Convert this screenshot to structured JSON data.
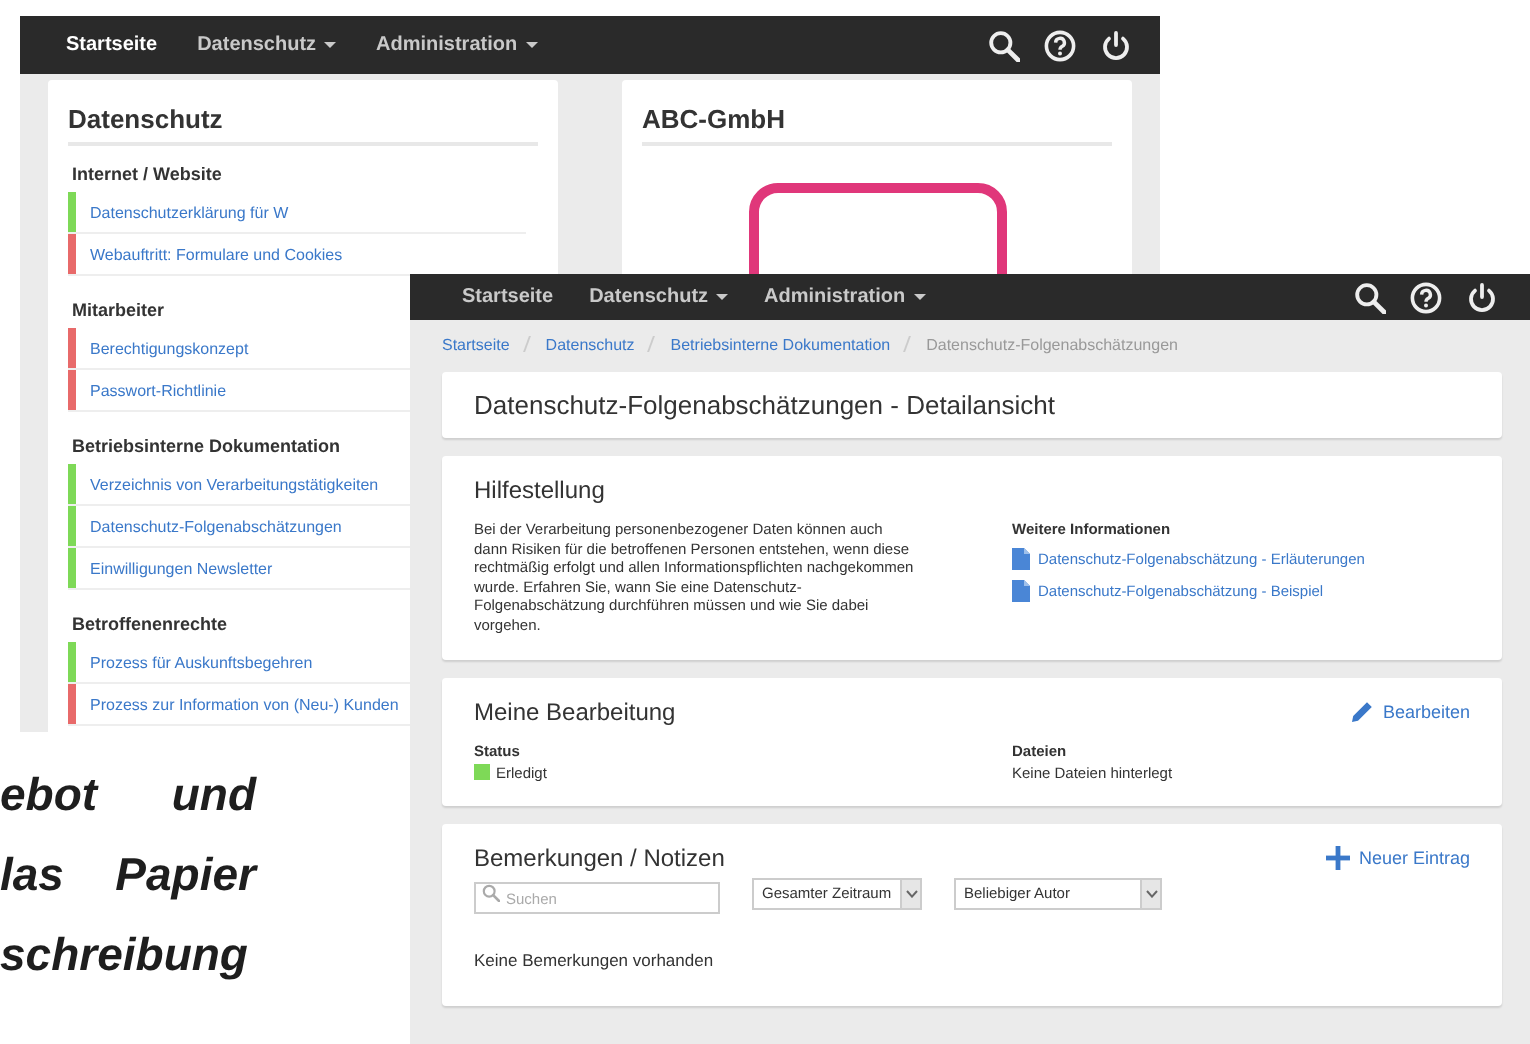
{
  "back_window": {
    "nav": [
      {
        "label": "Startseite",
        "selected": true,
        "dropdown": false
      },
      {
        "label": "Datenschutz",
        "selected": false,
        "dropdown": true
      },
      {
        "label": "Administration",
        "selected": false,
        "dropdown": true
      }
    ],
    "privacy_card": {
      "title": "Datenschutz",
      "groups": [
        {
          "heading": "Internet / Website",
          "items": [
            {
              "label": "Datenschutzerklärung für W",
              "color": "#7ed957"
            },
            {
              "label": "Webauftritt: Formulare und Cookies",
              "color": "#e86a6a"
            }
          ]
        },
        {
          "heading": "Mitarbeiter",
          "items": [
            {
              "label": "Berechtigungskonzept",
              "color": "#e86a6a"
            },
            {
              "label": "Passwort-Richtlinie",
              "color": "#e86a6a"
            }
          ]
        },
        {
          "heading": "Betriebsinterne Dokumentation",
          "items": [
            {
              "label": "Verzeichnis von Verarbeitungstätigkeiten",
              "color": "#7ed957"
            },
            {
              "label": "Datenschutz-Folgenabschätzungen",
              "color": "#7ed957"
            },
            {
              "label": "Einwilligungen Newsletter",
              "color": "#7ed957"
            }
          ]
        },
        {
          "heading": "Betroffenenrechte",
          "items": [
            {
              "label": "Prozess für Auskunftsbegehren",
              "color": "#7ed957"
            },
            {
              "label": "Prozess zur Information von (Neu-) Kunden",
              "color": "#e86a6a"
            }
          ]
        }
      ]
    },
    "company_card": {
      "title": "ABC-GmbH"
    }
  },
  "front_window": {
    "nav": [
      {
        "label": "Startseite",
        "selected": false,
        "dropdown": false
      },
      {
        "label": "Datenschutz",
        "selected": false,
        "dropdown": true
      },
      {
        "label": "Administration",
        "selected": false,
        "dropdown": true
      }
    ],
    "breadcrumb": [
      "Startseite",
      "Datenschutz",
      "Betriebsinterne Dokumentation",
      "Datenschutz-Folgenabschätzungen"
    ],
    "page_title": "Datenschutz-Folgenabschätzungen - Detailansicht",
    "help": {
      "title": "Hilfestellung",
      "text": "Bei der Verarbeitung personenbezogener Daten können auch dann Risiken für die betroffenen Personen entstehen, wenn diese rechtmäßig erfolgt und allen Informationspflichten nachgekommen wurde. Erfahren Sie, wann Sie eine Datenschutz-Folgenabschätzung durchführen müssen und wie Sie dabei vorgehen.",
      "more_title": "Weitere Informationen",
      "links": [
        "Datenschutz-Folgenabschätzung - Erläuterungen",
        "Datenschutz-Folgenabschätzung - Beispiel"
      ]
    },
    "my_work": {
      "title": "Meine Bearbeitung",
      "edit": "Bearbeiten",
      "status_label": "Status",
      "status": "Erledigt",
      "completed": true,
      "files_label": "Dateien",
      "files": "Keine Dateien hinterlegt"
    },
    "notes": {
      "title": "Bemerkungen / Notizen",
      "new_entry": "Neuer Eintrag",
      "search": {
        "placeholder": "Suchen"
      },
      "period": "Gesamter Zeitraum",
      "author": "Beliebiger Autor",
      "empty": "Keine Bemerkungen vorhanden"
    }
  },
  "promo_text": [
    "ebot und",
    "las Papier",
    "schreibung"
  ]
}
